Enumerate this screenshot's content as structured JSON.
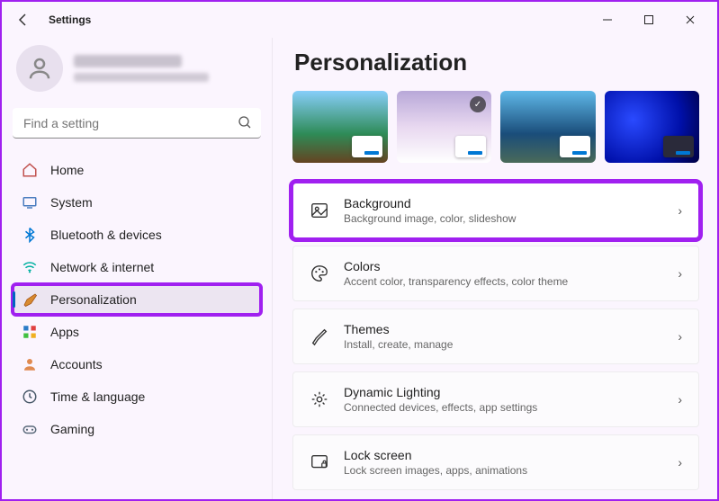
{
  "window": {
    "title": "Settings"
  },
  "search": {
    "placeholder": "Find a setting"
  },
  "nav": [
    {
      "id": "home",
      "label": "Home"
    },
    {
      "id": "system",
      "label": "System"
    },
    {
      "id": "bluetooth",
      "label": "Bluetooth & devices"
    },
    {
      "id": "network",
      "label": "Network & internet"
    },
    {
      "id": "personalization",
      "label": "Personalization"
    },
    {
      "id": "apps",
      "label": "Apps"
    },
    {
      "id": "accounts",
      "label": "Accounts"
    },
    {
      "id": "time",
      "label": "Time & language"
    },
    {
      "id": "gaming",
      "label": "Gaming"
    }
  ],
  "page": {
    "title": "Personalization"
  },
  "cards": [
    {
      "id": "background",
      "title": "Background",
      "sub": "Background image, color, slideshow"
    },
    {
      "id": "colors",
      "title": "Colors",
      "sub": "Accent color, transparency effects, color theme"
    },
    {
      "id": "themes",
      "title": "Themes",
      "sub": "Install, create, manage"
    },
    {
      "id": "dynamic",
      "title": "Dynamic Lighting",
      "sub": "Connected devices, effects, app settings"
    },
    {
      "id": "lock",
      "title": "Lock screen",
      "sub": "Lock screen images, apps, animations"
    }
  ]
}
